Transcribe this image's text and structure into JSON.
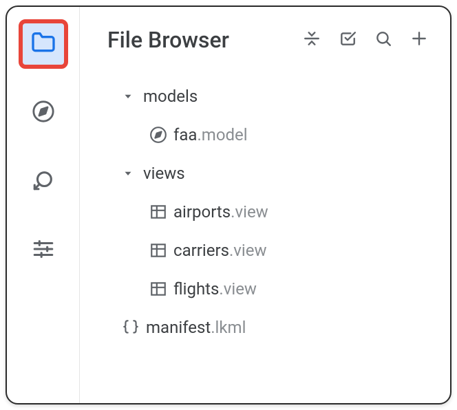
{
  "header": {
    "title": "File Browser"
  },
  "sidebar": {
    "items": [
      {
        "name": "folder",
        "active": true
      },
      {
        "name": "compass",
        "active": false
      },
      {
        "name": "history",
        "active": false
      },
      {
        "name": "sliders",
        "active": false
      }
    ]
  },
  "toolbar": {
    "items": [
      {
        "name": "collapse"
      },
      {
        "name": "checklist"
      },
      {
        "name": "search"
      },
      {
        "name": "add"
      }
    ]
  },
  "tree": {
    "folders": [
      {
        "name": "models",
        "expanded": true,
        "files": [
          {
            "base": "faa",
            "ext": ".model",
            "icon": "compass"
          }
        ]
      },
      {
        "name": "views",
        "expanded": true,
        "files": [
          {
            "base": "airports",
            "ext": ".view",
            "icon": "table"
          },
          {
            "base": "carriers",
            "ext": ".view",
            "icon": "table"
          },
          {
            "base": "flights",
            "ext": ".view",
            "icon": "table"
          }
        ]
      }
    ],
    "root_files": [
      {
        "base": "manifest",
        "ext": ".lkml",
        "icon": "braces"
      }
    ]
  }
}
